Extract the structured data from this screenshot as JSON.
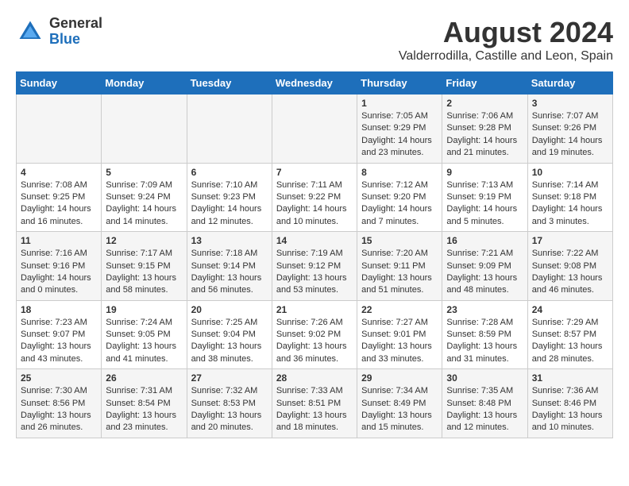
{
  "logo": {
    "general": "General",
    "blue": "Blue"
  },
  "title": {
    "month_year": "August 2024",
    "location": "Valderrodilla, Castille and Leon, Spain"
  },
  "weekdays": [
    "Sunday",
    "Monday",
    "Tuesday",
    "Wednesday",
    "Thursday",
    "Friday",
    "Saturday"
  ],
  "weeks": [
    [
      {
        "day": "",
        "info": ""
      },
      {
        "day": "",
        "info": ""
      },
      {
        "day": "",
        "info": ""
      },
      {
        "day": "",
        "info": ""
      },
      {
        "day": "1",
        "info": "Sunrise: 7:05 AM\nSunset: 9:29 PM\nDaylight: 14 hours\nand 23 minutes."
      },
      {
        "day": "2",
        "info": "Sunrise: 7:06 AM\nSunset: 9:28 PM\nDaylight: 14 hours\nand 21 minutes."
      },
      {
        "day": "3",
        "info": "Sunrise: 7:07 AM\nSunset: 9:26 PM\nDaylight: 14 hours\nand 19 minutes."
      }
    ],
    [
      {
        "day": "4",
        "info": "Sunrise: 7:08 AM\nSunset: 9:25 PM\nDaylight: 14 hours\nand 16 minutes."
      },
      {
        "day": "5",
        "info": "Sunrise: 7:09 AM\nSunset: 9:24 PM\nDaylight: 14 hours\nand 14 minutes."
      },
      {
        "day": "6",
        "info": "Sunrise: 7:10 AM\nSunset: 9:23 PM\nDaylight: 14 hours\nand 12 minutes."
      },
      {
        "day": "7",
        "info": "Sunrise: 7:11 AM\nSunset: 9:22 PM\nDaylight: 14 hours\nand 10 minutes."
      },
      {
        "day": "8",
        "info": "Sunrise: 7:12 AM\nSunset: 9:20 PM\nDaylight: 14 hours\nand 7 minutes."
      },
      {
        "day": "9",
        "info": "Sunrise: 7:13 AM\nSunset: 9:19 PM\nDaylight: 14 hours\nand 5 minutes."
      },
      {
        "day": "10",
        "info": "Sunrise: 7:14 AM\nSunset: 9:18 PM\nDaylight: 14 hours\nand 3 minutes."
      }
    ],
    [
      {
        "day": "11",
        "info": "Sunrise: 7:16 AM\nSunset: 9:16 PM\nDaylight: 14 hours\nand 0 minutes."
      },
      {
        "day": "12",
        "info": "Sunrise: 7:17 AM\nSunset: 9:15 PM\nDaylight: 13 hours\nand 58 minutes."
      },
      {
        "day": "13",
        "info": "Sunrise: 7:18 AM\nSunset: 9:14 PM\nDaylight: 13 hours\nand 56 minutes."
      },
      {
        "day": "14",
        "info": "Sunrise: 7:19 AM\nSunset: 9:12 PM\nDaylight: 13 hours\nand 53 minutes."
      },
      {
        "day": "15",
        "info": "Sunrise: 7:20 AM\nSunset: 9:11 PM\nDaylight: 13 hours\nand 51 minutes."
      },
      {
        "day": "16",
        "info": "Sunrise: 7:21 AM\nSunset: 9:09 PM\nDaylight: 13 hours\nand 48 minutes."
      },
      {
        "day": "17",
        "info": "Sunrise: 7:22 AM\nSunset: 9:08 PM\nDaylight: 13 hours\nand 46 minutes."
      }
    ],
    [
      {
        "day": "18",
        "info": "Sunrise: 7:23 AM\nSunset: 9:07 PM\nDaylight: 13 hours\nand 43 minutes."
      },
      {
        "day": "19",
        "info": "Sunrise: 7:24 AM\nSunset: 9:05 PM\nDaylight: 13 hours\nand 41 minutes."
      },
      {
        "day": "20",
        "info": "Sunrise: 7:25 AM\nSunset: 9:04 PM\nDaylight: 13 hours\nand 38 minutes."
      },
      {
        "day": "21",
        "info": "Sunrise: 7:26 AM\nSunset: 9:02 PM\nDaylight: 13 hours\nand 36 minutes."
      },
      {
        "day": "22",
        "info": "Sunrise: 7:27 AM\nSunset: 9:01 PM\nDaylight: 13 hours\nand 33 minutes."
      },
      {
        "day": "23",
        "info": "Sunrise: 7:28 AM\nSunset: 8:59 PM\nDaylight: 13 hours\nand 31 minutes."
      },
      {
        "day": "24",
        "info": "Sunrise: 7:29 AM\nSunset: 8:57 PM\nDaylight: 13 hours\nand 28 minutes."
      }
    ],
    [
      {
        "day": "25",
        "info": "Sunrise: 7:30 AM\nSunset: 8:56 PM\nDaylight: 13 hours\nand 26 minutes."
      },
      {
        "day": "26",
        "info": "Sunrise: 7:31 AM\nSunset: 8:54 PM\nDaylight: 13 hours\nand 23 minutes."
      },
      {
        "day": "27",
        "info": "Sunrise: 7:32 AM\nSunset: 8:53 PM\nDaylight: 13 hours\nand 20 minutes."
      },
      {
        "day": "28",
        "info": "Sunrise: 7:33 AM\nSunset: 8:51 PM\nDaylight: 13 hours\nand 18 minutes."
      },
      {
        "day": "29",
        "info": "Sunrise: 7:34 AM\nSunset: 8:49 PM\nDaylight: 13 hours\nand 15 minutes."
      },
      {
        "day": "30",
        "info": "Sunrise: 7:35 AM\nSunset: 8:48 PM\nDaylight: 13 hours\nand 12 minutes."
      },
      {
        "day": "31",
        "info": "Sunrise: 7:36 AM\nSunset: 8:46 PM\nDaylight: 13 hours\nand 10 minutes."
      }
    ]
  ]
}
